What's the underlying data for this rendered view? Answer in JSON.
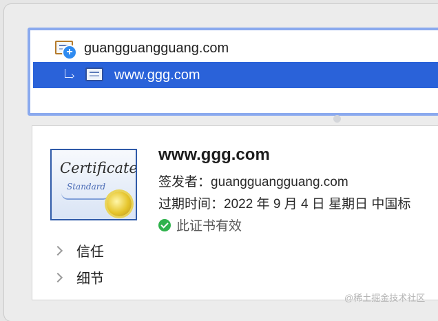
{
  "tree": {
    "root_label": "guangguangguang.com",
    "child_label": "www.ggg.com"
  },
  "detail": {
    "certificate_image": {
      "script_text": "Certificate",
      "sub_text": "Standard"
    },
    "title": "www.ggg.com",
    "issuer_label": "签发者：",
    "issuer_value": "guangguangguang.com",
    "expiry_label": "过期时间：",
    "expiry_value": "2022 年 9 月 4 日 星期日 中国标",
    "validity_text": "此证书有效",
    "sections": [
      {
        "label": "信任"
      },
      {
        "label": "细节"
      }
    ]
  },
  "watermark": "@稀土掘金技术社区",
  "colors": {
    "selection": "#2a62d9",
    "focus_border": "#8aa9ee",
    "valid_check": "#2fb24c"
  },
  "icons": [
    "certificate-icon",
    "add-badge-icon",
    "tree-branch-icon",
    "certificate-icon",
    "check-circle-icon",
    "chevron-right-icon"
  ]
}
